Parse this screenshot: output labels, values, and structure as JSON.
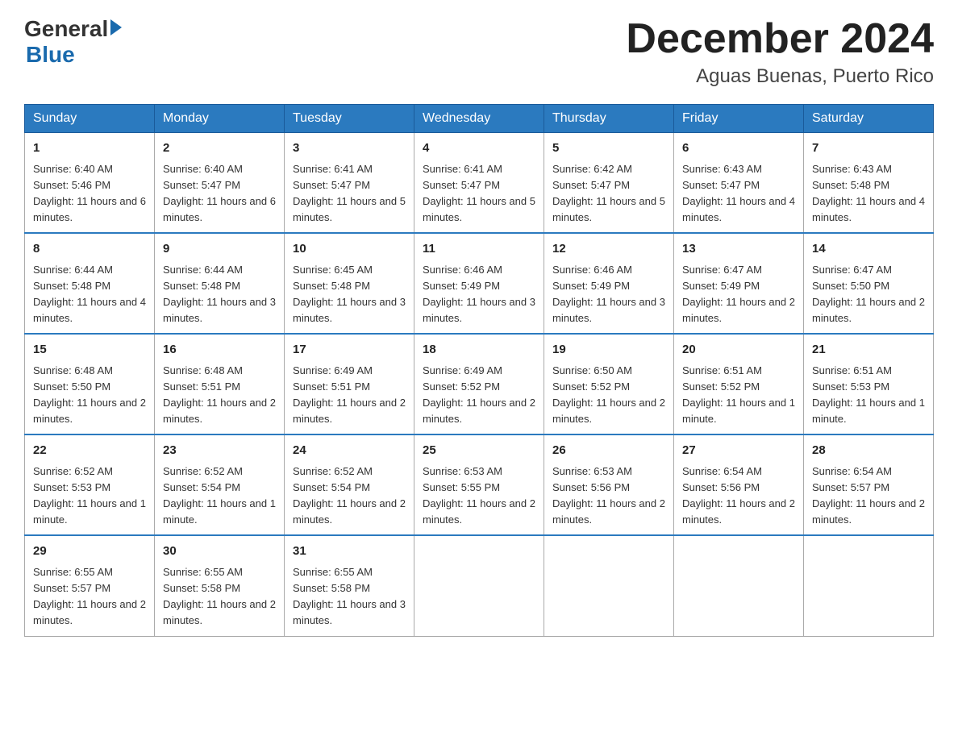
{
  "logo": {
    "general": "General",
    "blue": "Blue"
  },
  "title": "December 2024",
  "location": "Aguas Buenas, Puerto Rico",
  "headers": [
    "Sunday",
    "Monday",
    "Tuesday",
    "Wednesday",
    "Thursday",
    "Friday",
    "Saturday"
  ],
  "weeks": [
    [
      {
        "day": "1",
        "sunrise": "6:40 AM",
        "sunset": "5:46 PM",
        "daylight": "11 hours and 6 minutes."
      },
      {
        "day": "2",
        "sunrise": "6:40 AM",
        "sunset": "5:47 PM",
        "daylight": "11 hours and 6 minutes."
      },
      {
        "day": "3",
        "sunrise": "6:41 AM",
        "sunset": "5:47 PM",
        "daylight": "11 hours and 5 minutes."
      },
      {
        "day": "4",
        "sunrise": "6:41 AM",
        "sunset": "5:47 PM",
        "daylight": "11 hours and 5 minutes."
      },
      {
        "day": "5",
        "sunrise": "6:42 AM",
        "sunset": "5:47 PM",
        "daylight": "11 hours and 5 minutes."
      },
      {
        "day": "6",
        "sunrise": "6:43 AM",
        "sunset": "5:47 PM",
        "daylight": "11 hours and 4 minutes."
      },
      {
        "day": "7",
        "sunrise": "6:43 AM",
        "sunset": "5:48 PM",
        "daylight": "11 hours and 4 minutes."
      }
    ],
    [
      {
        "day": "8",
        "sunrise": "6:44 AM",
        "sunset": "5:48 PM",
        "daylight": "11 hours and 4 minutes."
      },
      {
        "day": "9",
        "sunrise": "6:44 AM",
        "sunset": "5:48 PM",
        "daylight": "11 hours and 3 minutes."
      },
      {
        "day": "10",
        "sunrise": "6:45 AM",
        "sunset": "5:48 PM",
        "daylight": "11 hours and 3 minutes."
      },
      {
        "day": "11",
        "sunrise": "6:46 AM",
        "sunset": "5:49 PM",
        "daylight": "11 hours and 3 minutes."
      },
      {
        "day": "12",
        "sunrise": "6:46 AM",
        "sunset": "5:49 PM",
        "daylight": "11 hours and 3 minutes."
      },
      {
        "day": "13",
        "sunrise": "6:47 AM",
        "sunset": "5:49 PM",
        "daylight": "11 hours and 2 minutes."
      },
      {
        "day": "14",
        "sunrise": "6:47 AM",
        "sunset": "5:50 PM",
        "daylight": "11 hours and 2 minutes."
      }
    ],
    [
      {
        "day": "15",
        "sunrise": "6:48 AM",
        "sunset": "5:50 PM",
        "daylight": "11 hours and 2 minutes."
      },
      {
        "day": "16",
        "sunrise": "6:48 AM",
        "sunset": "5:51 PM",
        "daylight": "11 hours and 2 minutes."
      },
      {
        "day": "17",
        "sunrise": "6:49 AM",
        "sunset": "5:51 PM",
        "daylight": "11 hours and 2 minutes."
      },
      {
        "day": "18",
        "sunrise": "6:49 AM",
        "sunset": "5:52 PM",
        "daylight": "11 hours and 2 minutes."
      },
      {
        "day": "19",
        "sunrise": "6:50 AM",
        "sunset": "5:52 PM",
        "daylight": "11 hours and 2 minutes."
      },
      {
        "day": "20",
        "sunrise": "6:51 AM",
        "sunset": "5:52 PM",
        "daylight": "11 hours and 1 minute."
      },
      {
        "day": "21",
        "sunrise": "6:51 AM",
        "sunset": "5:53 PM",
        "daylight": "11 hours and 1 minute."
      }
    ],
    [
      {
        "day": "22",
        "sunrise": "6:52 AM",
        "sunset": "5:53 PM",
        "daylight": "11 hours and 1 minute."
      },
      {
        "day": "23",
        "sunrise": "6:52 AM",
        "sunset": "5:54 PM",
        "daylight": "11 hours and 1 minute."
      },
      {
        "day": "24",
        "sunrise": "6:52 AM",
        "sunset": "5:54 PM",
        "daylight": "11 hours and 2 minutes."
      },
      {
        "day": "25",
        "sunrise": "6:53 AM",
        "sunset": "5:55 PM",
        "daylight": "11 hours and 2 minutes."
      },
      {
        "day": "26",
        "sunrise": "6:53 AM",
        "sunset": "5:56 PM",
        "daylight": "11 hours and 2 minutes."
      },
      {
        "day": "27",
        "sunrise": "6:54 AM",
        "sunset": "5:56 PM",
        "daylight": "11 hours and 2 minutes."
      },
      {
        "day": "28",
        "sunrise": "6:54 AM",
        "sunset": "5:57 PM",
        "daylight": "11 hours and 2 minutes."
      }
    ],
    [
      {
        "day": "29",
        "sunrise": "6:55 AM",
        "sunset": "5:57 PM",
        "daylight": "11 hours and 2 minutes."
      },
      {
        "day": "30",
        "sunrise": "6:55 AM",
        "sunset": "5:58 PM",
        "daylight": "11 hours and 2 minutes."
      },
      {
        "day": "31",
        "sunrise": "6:55 AM",
        "sunset": "5:58 PM",
        "daylight": "11 hours and 3 minutes."
      },
      null,
      null,
      null,
      null
    ]
  ]
}
